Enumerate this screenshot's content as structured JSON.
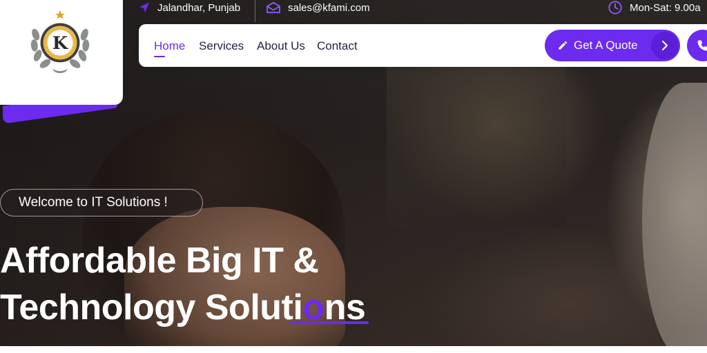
{
  "topbar": {
    "location": {
      "icon": "location-arrow-icon",
      "text": "Jalandhar, Punjab"
    },
    "email": {
      "icon": "envelope-icon",
      "text": "sales@kfami.com"
    },
    "hours": {
      "icon": "clock-icon",
      "text": "Mon-Sat: 9.00a"
    }
  },
  "logo": {
    "letter": "K"
  },
  "nav": {
    "links": [
      "Home",
      "Services",
      "About Us",
      "Contact"
    ],
    "active": "Home",
    "quote_label": "Get A Quote"
  },
  "hero": {
    "welcome": "Welcome to IT Solutions !",
    "headline_line1": "Affordable Big IT &",
    "headline_line2_a": "Technology Soluti",
    "headline_line2_o": "o",
    "headline_line2_b": "ns"
  },
  "colors": {
    "accent": "#6c2bef",
    "text_dark": "#1f2340",
    "white": "#ffffff"
  }
}
